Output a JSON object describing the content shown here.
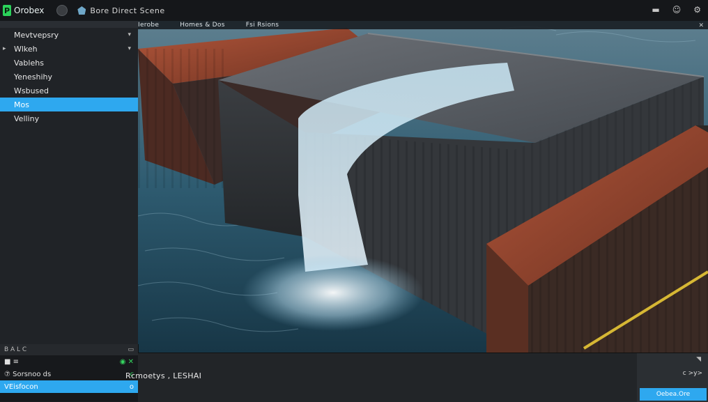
{
  "titlebar": {
    "app_name": "Orobex",
    "logo_letter": "P",
    "scene_title": "Bore Direct Scene",
    "controls": [
      "▬",
      "☺",
      "⚙"
    ]
  },
  "viewport": {
    "tabs": [
      "Ierobe",
      "Homes & Dos",
      "Fsi Rsions"
    ],
    "corner": "✕"
  },
  "outliner": {
    "items": [
      {
        "label": "Mevtvepsry",
        "chev": "▾",
        "lead": ""
      },
      {
        "label": "Wlkeh",
        "chev": "▾",
        "lead": "▸"
      },
      {
        "label": "Vablehs",
        "chev": "",
        "lead": ""
      },
      {
        "label": "Yeneshihy",
        "chev": "",
        "lead": ""
      },
      {
        "label": "Wsbused",
        "chev": "",
        "lead": ""
      },
      {
        "label": "Mos",
        "chev": "",
        "lead": "",
        "selected": true
      },
      {
        "label": "Velliny",
        "chev": "",
        "lead": ""
      }
    ]
  },
  "bottom_left": {
    "header": "B A L C",
    "rows": [
      {
        "left": "■ ≡",
        "right": "◉ ✕"
      },
      {
        "left": "⑦ Sorsnoo ds",
        "right": "c"
      },
      {
        "left": "VEisfocon",
        "right": "o",
        "selected": true
      }
    ]
  },
  "bottom_bar": {
    "label": "Rcmoetys , LESHAI",
    "right_top": "◥",
    "right_mid": "c >y>",
    "button": "Oebea.Ore"
  },
  "colors": {
    "accent": "#2ea8ef",
    "logo": "#2bd25a"
  }
}
